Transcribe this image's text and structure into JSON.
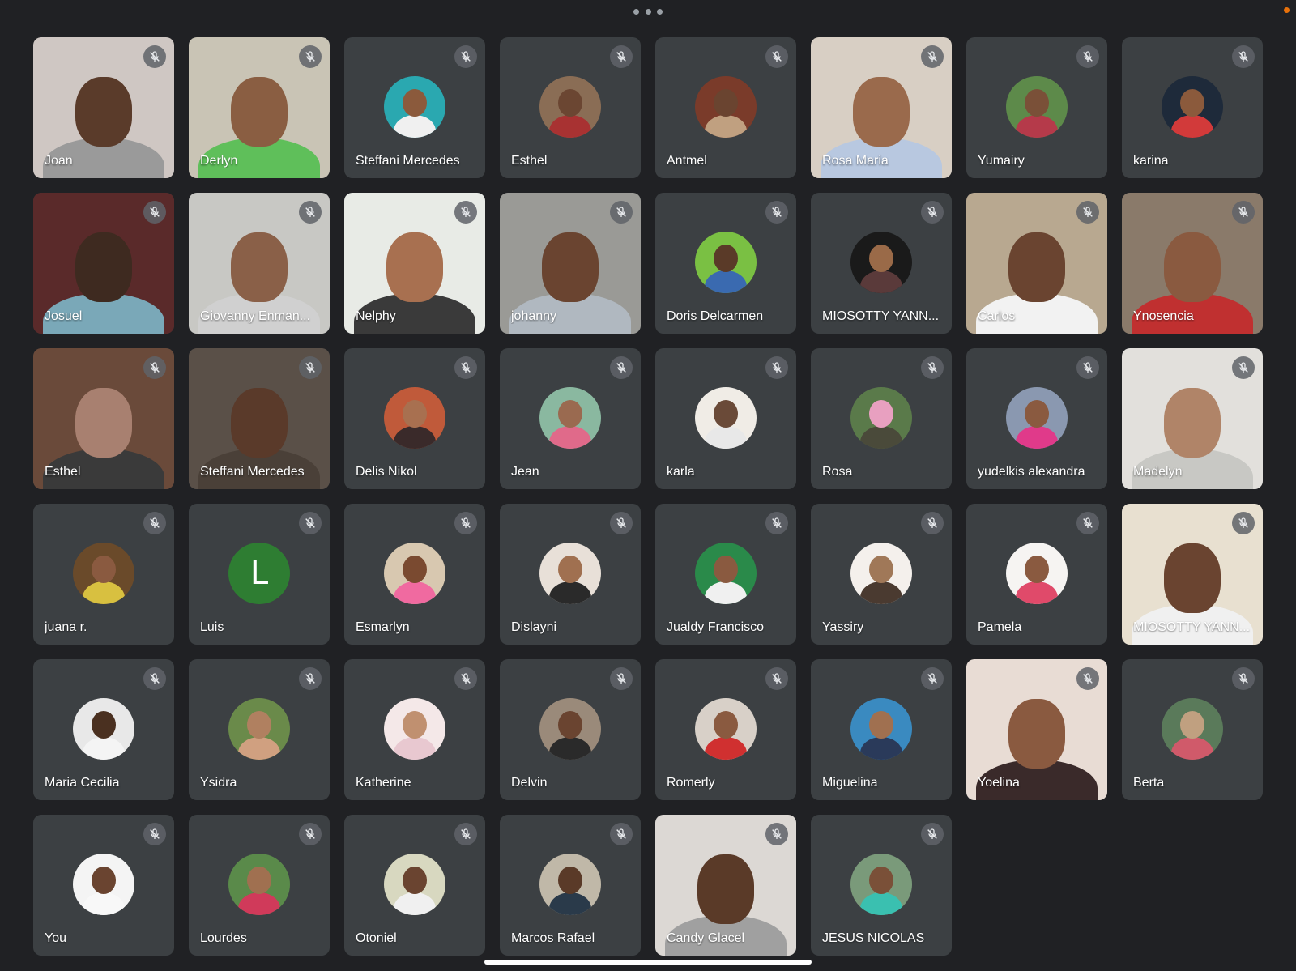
{
  "meeting": {
    "more_options_icon": "more-horiz-icon",
    "recording_indicator_color": "#e8710a",
    "muted_icon": "mic-off-icon"
  },
  "participants": [
    {
      "name": "Joan",
      "type": "video",
      "bg": "#cfc7c3",
      "skin": "#5a3b2a",
      "shirt": "#9a9a9a"
    },
    {
      "name": "Derlyn",
      "type": "video",
      "bg": "#c9c4b5",
      "skin": "#8a5e42",
      "shirt": "#5fbf5a"
    },
    {
      "name": "Steffani Mercedes",
      "type": "avatar",
      "bg": "#2aa8b0",
      "skin": "#8b5a3c",
      "shirt": "#f0f0f0"
    },
    {
      "name": "Esthel",
      "type": "avatar",
      "bg": "#8a6d55",
      "skin": "#6b4632",
      "shirt": "#a83232"
    },
    {
      "name": "Antmel",
      "type": "avatar",
      "bg": "#7a3b2a",
      "skin": "#6a4430",
      "shirt": "#c0a080"
    },
    {
      "name": "Rosa Maria",
      "type": "video",
      "bg": "#d8cfc4",
      "skin": "#9a6a4c",
      "shirt": "#b8c8e0"
    },
    {
      "name": "Yumairy",
      "type": "avatar",
      "bg": "#5d8a4a",
      "skin": "#7a5038",
      "shirt": "#b53a4a"
    },
    {
      "name": "karina",
      "type": "avatar",
      "bg": "#1e2a3a",
      "skin": "#8b5a3c",
      "shirt": "#d23a3a"
    },
    {
      "name": "Josuel",
      "type": "video",
      "bg": "#5a2a2a",
      "skin": "#3e2a20",
      "shirt": "#7aa8b8"
    },
    {
      "name": "Giovanny Enman...",
      "type": "video",
      "bg": "#c8c8c4",
      "skin": "#8a6048",
      "shirt": "#d0d0d0"
    },
    {
      "name": "Nelphy",
      "type": "video",
      "bg": "#e8ebe6",
      "skin": "#a87050",
      "shirt": "#3a3a3a"
    },
    {
      "name": "johanny",
      "type": "video",
      "bg": "#9a9a96",
      "skin": "#6a4430",
      "shirt": "#b0b8c0"
    },
    {
      "name": "Doris Delcarmen",
      "type": "avatar",
      "bg": "#7ac043",
      "skin": "#5a3a28",
      "shirt": "#3a6ab0"
    },
    {
      "name": "MIOSOTTY YANN...",
      "type": "avatar",
      "bg": "#1a1a1a",
      "skin": "#9a6a48",
      "shirt": "#5a3a3a"
    },
    {
      "name": "Carlos",
      "type": "video",
      "bg": "#b8a890",
      "skin": "#6a4430",
      "shirt": "#f2f2f2"
    },
    {
      "name": "Ynosencia",
      "type": "video",
      "bg": "#8a7a6a",
      "skin": "#8a5a40",
      "shirt": "#c03030"
    },
    {
      "name": "Esthel",
      "type": "video",
      "bg": "#6a4a3a",
      "skin": "#a88070",
      "shirt": "#3a3a3a"
    },
    {
      "name": "Steffani Mercedes",
      "type": "video",
      "bg": "#5a5048",
      "skin": "#5a3a2a",
      "shirt": "#4a4038"
    },
    {
      "name": "Delis Nikol",
      "type": "avatar",
      "bg": "#c05a3a",
      "skin": "#a87050",
      "shirt": "#3a2a2a"
    },
    {
      "name": "Jean",
      "type": "avatar",
      "bg": "#8ab8a0",
      "skin": "#9a6a50",
      "shirt": "#e06a8a"
    },
    {
      "name": "karla",
      "type": "avatar",
      "bg": "#f0ece6",
      "skin": "#6a4a38",
      "shirt": "#e8e8e8"
    },
    {
      "name": "Rosa",
      "type": "avatar",
      "bg": "#5a7a4a",
      "skin": "#e8a0c0",
      "shirt": "#4a4a3a"
    },
    {
      "name": "yudelkis alexandra",
      "type": "avatar",
      "bg": "#8a98b0",
      "skin": "#8a5a40",
      "shirt": "#e03a8a"
    },
    {
      "name": "Madelyn",
      "type": "video",
      "bg": "#e2e0dc",
      "skin": "#b08468",
      "shirt": "#c8c8c4"
    },
    {
      "name": "juana r.",
      "type": "avatar",
      "bg": "#6a4a2a",
      "skin": "#8a5a40",
      "shirt": "#d8c040"
    },
    {
      "name": "Luis",
      "type": "letter",
      "letter": "L",
      "bg": "#2e7d32"
    },
    {
      "name": "Esmarlyn",
      "type": "avatar",
      "bg": "#d8c8b0",
      "skin": "#7a4a30",
      "shirt": "#f06aa0"
    },
    {
      "name": "Dislayni",
      "type": "avatar",
      "bg": "#e8e0d8",
      "skin": "#a07050",
      "shirt": "#2a2a2a"
    },
    {
      "name": "Jualdy Francisco",
      "type": "avatar",
      "bg": "#2a8a4a",
      "skin": "#8a5a40",
      "shirt": "#f0f0f0"
    },
    {
      "name": "Yassiry",
      "type": "avatar",
      "bg": "#f4f0ec",
      "skin": "#a07858",
      "shirt": "#4a3a30"
    },
    {
      "name": "Pamela",
      "type": "avatar",
      "bg": "#f6f4f2",
      "skin": "#8a5a40",
      "shirt": "#e04a6a"
    },
    {
      "name": "MIOSOTTY YANN...",
      "type": "video",
      "bg": "#e8e0d0",
      "skin": "#6a4430",
      "shirt": "#f0f0f0"
    },
    {
      "name": "Maria Cecilia",
      "type": "avatar",
      "bg": "#e8e8e8",
      "skin": "#4a3020",
      "shirt": "#f4f4f4"
    },
    {
      "name": "Ysidra",
      "type": "avatar",
      "bg": "#6a8a4a",
      "skin": "#b08060",
      "shirt": "#d0a080"
    },
    {
      "name": "Katherine",
      "type": "avatar",
      "bg": "#f4e8e8",
      "skin": "#c09070",
      "shirt": "#e8c8d0"
    },
    {
      "name": "Delvin",
      "type": "avatar",
      "bg": "#9a8a7a",
      "skin": "#6a4430",
      "shirt": "#2a2a2a"
    },
    {
      "name": "Romerly",
      "type": "avatar",
      "bg": "#d8d0c8",
      "skin": "#8a5a40",
      "shirt": "#d03030"
    },
    {
      "name": "Miguelina",
      "type": "avatar",
      "bg": "#3a8ac0",
      "skin": "#a07050",
      "shirt": "#2a3a5a"
    },
    {
      "name": "Yoelina",
      "type": "video",
      "bg": "#e8dcd4",
      "skin": "#8a5a40",
      "shirt": "#3a2a2a"
    },
    {
      "name": "Berta",
      "type": "avatar",
      "bg": "#5a7a5a",
      "skin": "#c0a080",
      "shirt": "#d05a6a"
    },
    {
      "name": "You",
      "type": "avatar",
      "bg": "#f4f4f4",
      "skin": "#6a4430",
      "shirt": "#f8f8f8"
    },
    {
      "name": "Lourdes",
      "type": "avatar",
      "bg": "#5a8a4a",
      "skin": "#a07050",
      "shirt": "#d03a5a"
    },
    {
      "name": "Otoniel",
      "type": "avatar",
      "bg": "#d8d8c0",
      "skin": "#6a4430",
      "shirt": "#f0f0f0"
    },
    {
      "name": "Marcos Rafael",
      "type": "avatar",
      "bg": "#c0b8a8",
      "skin": "#5a3a28",
      "shirt": "#2a3a4a"
    },
    {
      "name": "Candy Glacel",
      "type": "video",
      "bg": "#dcd8d4",
      "skin": "#5a3a28",
      "shirt": "#a0a0a0"
    },
    {
      "name": "JESUS NICOLAS",
      "type": "avatar",
      "bg": "#7a9a7a",
      "skin": "#7a5038",
      "shirt": "#3ac0b0"
    }
  ]
}
